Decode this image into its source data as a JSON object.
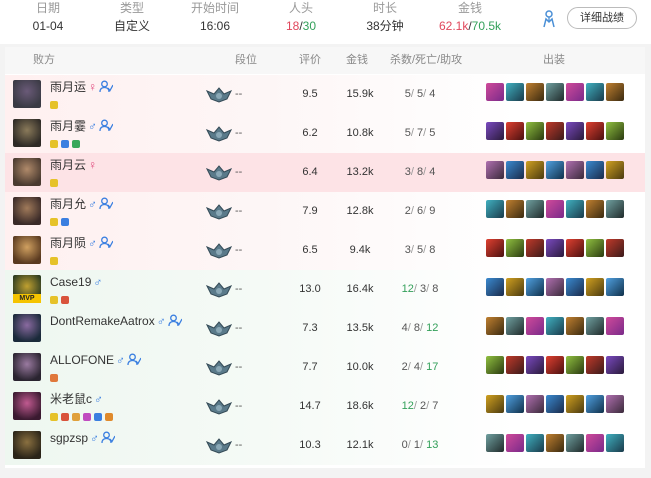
{
  "summary": {
    "date_label": "日期",
    "date": "01-04",
    "type_label": "类型",
    "type": "自定义",
    "start_label": "开始时间",
    "start": "16:06",
    "kills_label": "人头",
    "kills_red": "18",
    "kills_sep": "/",
    "kills_green": "30",
    "duration_label": "时长",
    "duration": "38分钟",
    "gold_label": "金钱",
    "gold_red": "62.1k",
    "gold_sep": "/",
    "gold_green": "70.5k",
    "detail_button": "详细战绩"
  },
  "columns": {
    "team": "败方",
    "rank": "段位",
    "score": "评价",
    "gold": "金钱",
    "kda": "杀数/死亡/助攻",
    "items": "出装"
  },
  "colors": {
    "red": "#e0475c",
    "green": "#33a05a",
    "male": "#3b7fe0",
    "female": "#e0477c"
  },
  "players": [
    {
      "name": "雨月运",
      "gender": "♀",
      "friend": true,
      "rank": "--",
      "score": "9.5",
      "gold": "15.9k",
      "k": "5",
      "d": "5",
      "a": "4",
      "team": "lose",
      "highlight": false,
      "mvp": false,
      "badges": [
        "#e6c229"
      ]
    },
    {
      "name": "雨月霎",
      "gender": "♂",
      "friend": true,
      "rank": "--",
      "score": "6.2",
      "gold": "10.8k",
      "k": "5",
      "d": "7",
      "a": "5",
      "team": "lose",
      "highlight": false,
      "mvp": false,
      "badges": [
        "#e6c229",
        "#3b7fe0",
        "#38a85a"
      ]
    },
    {
      "name": "雨月云",
      "gender": "♀",
      "friend": false,
      "rank": "--",
      "score": "6.4",
      "gold": "13.2k",
      "k": "3",
      "d": "8",
      "a": "4",
      "team": "lose",
      "highlight": true,
      "mvp": false,
      "badges": [
        "#e6c229"
      ]
    },
    {
      "name": "雨月允",
      "gender": "♂",
      "friend": true,
      "rank": "--",
      "score": "7.9",
      "gold": "12.8k",
      "k": "2",
      "d": "6",
      "a": "9",
      "team": "lose",
      "highlight": false,
      "mvp": false,
      "badges": [
        "#e6c229",
        "#3b7fe0"
      ]
    },
    {
      "name": "雨月陨",
      "gender": "♂",
      "friend": true,
      "rank": "--",
      "score": "6.5",
      "gold": "9.4k",
      "k": "3",
      "d": "5",
      "a": "8",
      "team": "lose",
      "highlight": false,
      "mvp": false,
      "badges": [
        "#e6c229"
      ]
    },
    {
      "name": "Case19",
      "gender": "♂",
      "friend": false,
      "rank": "--",
      "score": "13.0",
      "gold": "16.4k",
      "k": "12",
      "d": "3",
      "a": "8",
      "team": "win",
      "highlight": false,
      "mvp": true,
      "mvp_text": "MVP",
      "badges": [
        "#e6c229",
        "#d9533b"
      ]
    },
    {
      "name": "DontRemakeAatrox",
      "gender": "♂",
      "friend": true,
      "rank": "--",
      "score": "7.3",
      "gold": "13.5k",
      "k": "4",
      "d": "8",
      "a": "12",
      "team": "win",
      "highlight": false,
      "mvp": false,
      "badges": []
    },
    {
      "name": "ALLOFONE",
      "gender": "♂",
      "friend": true,
      "rank": "--",
      "score": "7.7",
      "gold": "10.0k",
      "k": "2",
      "d": "4",
      "a": "17",
      "team": "win",
      "highlight": false,
      "mvp": false,
      "badges": [
        "#e0783b"
      ]
    },
    {
      "name": "米老鼠c",
      "gender": "♂",
      "friend": false,
      "rank": "--",
      "score": "14.7",
      "gold": "18.6k",
      "k": "12",
      "d": "2",
      "a": "7",
      "team": "win",
      "highlight": false,
      "mvp": false,
      "badges": [
        "#e6c229",
        "#d9533b",
        "#e0a03b",
        "#c04cc0",
        "#3b7fe0",
        "#e08a2b"
      ]
    },
    {
      "name": "sgpzsp",
      "gender": "♂",
      "friend": true,
      "rank": "--",
      "score": "10.3",
      "gold": "12.1k",
      "k": "0",
      "d": "1",
      "a": "13",
      "team": "win",
      "highlight": false,
      "mvp": false,
      "badges": []
    }
  ]
}
